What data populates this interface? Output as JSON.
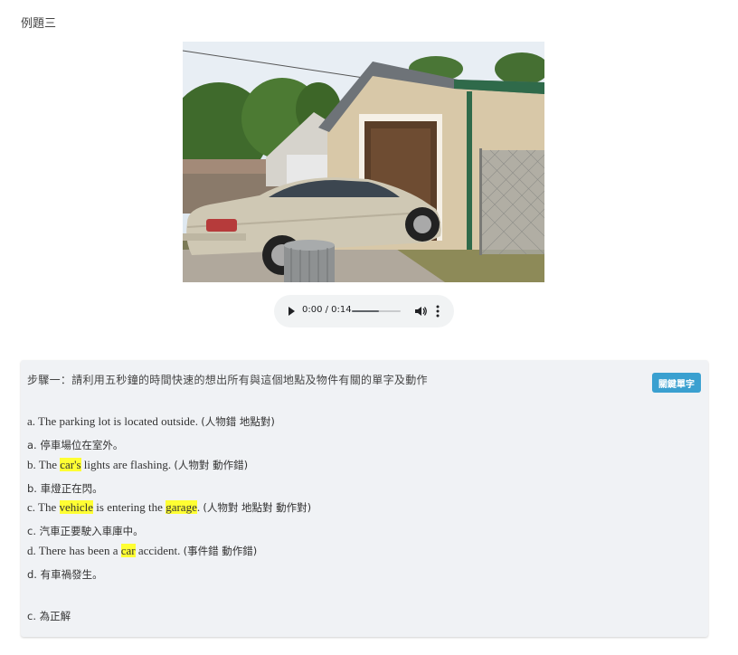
{
  "example_title": "例題三",
  "audio": {
    "time": "0:00 / 0:14",
    "progress_fraction": 0.55
  },
  "panel": {
    "step_text": "步驟一：請利用五秒鐘的時間快速的想出所有與這個地點及物件有關的單字及動作",
    "vocab_button": "關鍵單字",
    "options": [
      {
        "en_parts": [
          "a. The parking lot is located outside. "
        ],
        "tag": "(人物錯 地點對)",
        "zh": "a. 停車場位在室外。"
      },
      {
        "en_parts": [
          "b. The ",
          "car's",
          " lights are flashing. "
        ],
        "tag": "(人物對 動作錯)",
        "zh": "b. 車燈正在閃。"
      },
      {
        "en_parts": [
          "c. The ",
          "vehicle",
          " is entering the ",
          "garage",
          ". "
        ],
        "tag": "(人物對 地點對 動作對)",
        "zh": "c. 汽車正要駛入車庫中。"
      },
      {
        "en_parts": [
          "d. There has been a ",
          "car",
          " accident. "
        ],
        "tag": "(事件錯 動作錯)",
        "zh": "d. 有車禍發生。"
      }
    ],
    "answer": "c. 為正解"
  },
  "colors": {
    "highlight": "#ffff33",
    "button": "#3aa0d0",
    "panel_bg": "#f0f2f5"
  }
}
